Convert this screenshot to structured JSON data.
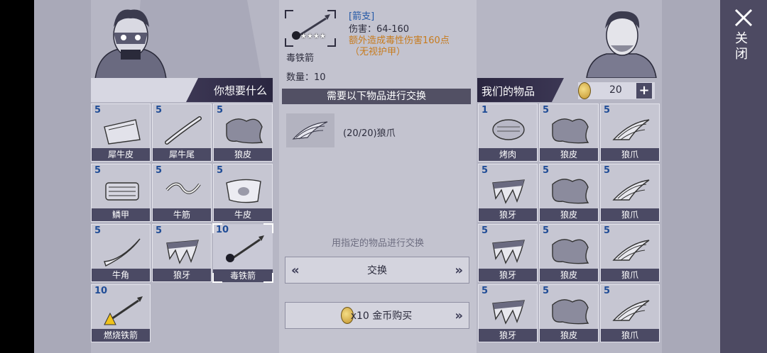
{
  "want_panel": {
    "title": "你想要什么",
    "items": [
      {
        "count": "5",
        "label": "犀牛皮",
        "icon": "rhino-hide-icon"
      },
      {
        "count": "5",
        "label": "犀牛尾",
        "icon": "rhino-tail-icon"
      },
      {
        "count": "5",
        "label": "狼皮",
        "icon": "wolf-pelt-icon"
      },
      {
        "count": "5",
        "label": "鳞甲",
        "icon": "scale-armor-icon"
      },
      {
        "count": "5",
        "label": "牛筋",
        "icon": "sinew-icon"
      },
      {
        "count": "5",
        "label": "牛皮",
        "icon": "cowhide-icon"
      },
      {
        "count": "5",
        "label": "牛角",
        "icon": "horn-icon"
      },
      {
        "count": "5",
        "label": "狼牙",
        "icon": "wolf-fang-icon"
      },
      {
        "count": "10",
        "label": "毒铁箭",
        "icon": "poison-arrow-icon",
        "selected": true
      },
      {
        "count": "10",
        "label": "燃烧铁箭",
        "icon": "fire-arrow-icon"
      }
    ]
  },
  "detail": {
    "category": "[箭支]",
    "damage": "伤害：64-160",
    "extra": "额外造成毒性伤害160点",
    "extra2": "（无视护甲）",
    "name": "毒铁箭",
    "quantity": "数量：10",
    "stars": "★★★★",
    "need_title": "需要以下物品进行交换",
    "need_item": "(20/20)狼爪",
    "hint": "用指定的物品进行交换",
    "exchange_label": "交换",
    "buy_label": "x10 金币购买",
    "arrow_left": "«",
    "arrow_right": "»"
  },
  "our_panel": {
    "title": "我们的物品",
    "gold": "20",
    "plus": "+",
    "items": [
      {
        "count": "1",
        "label": "烤肉",
        "icon": "roast-meat-icon"
      },
      {
        "count": "5",
        "label": "狼皮",
        "icon": "wolf-pelt-icon"
      },
      {
        "count": "5",
        "label": "狼爪",
        "icon": "wolf-claw-icon"
      },
      {
        "count": "5",
        "label": "狼牙",
        "icon": "wolf-fang-icon"
      },
      {
        "count": "5",
        "label": "狼皮",
        "icon": "wolf-pelt-icon"
      },
      {
        "count": "5",
        "label": "狼爪",
        "icon": "wolf-claw-icon"
      },
      {
        "count": "5",
        "label": "狼牙",
        "icon": "wolf-fang-icon"
      },
      {
        "count": "5",
        "label": "狼皮",
        "icon": "wolf-pelt-icon"
      },
      {
        "count": "5",
        "label": "狼爪",
        "icon": "wolf-claw-icon"
      },
      {
        "count": "5",
        "label": "狼牙",
        "icon": "wolf-fang-icon"
      },
      {
        "count": "5",
        "label": "狼皮",
        "icon": "wolf-pelt-icon"
      },
      {
        "count": "5",
        "label": "狼爪",
        "icon": "wolf-claw-icon"
      }
    ]
  },
  "close_label": "关闭",
  "colors": {
    "accent": "#3c3754",
    "count": "#1f4c96",
    "gold_text": "#c77b1d",
    "category": "#2458a6"
  }
}
